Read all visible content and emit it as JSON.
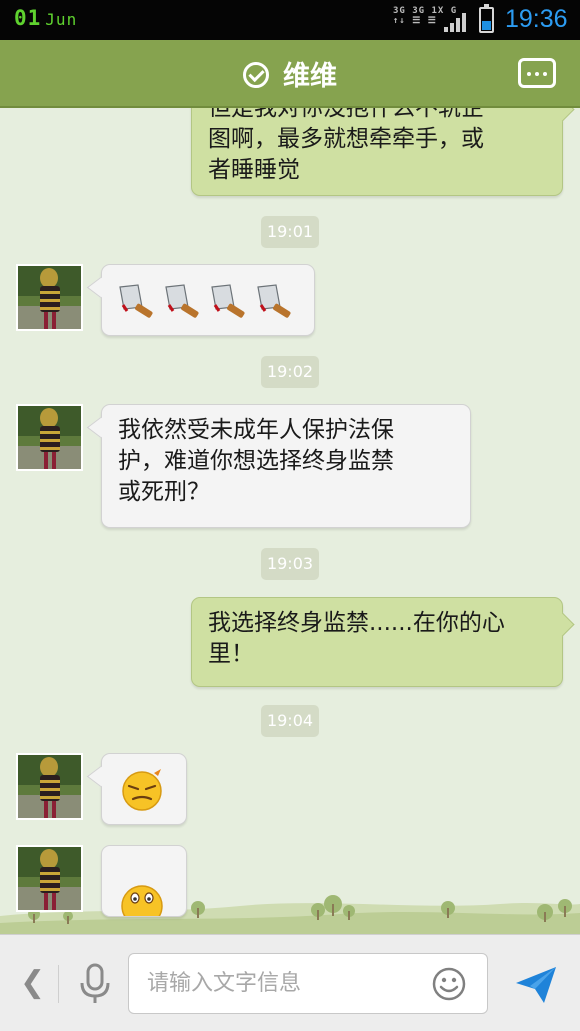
{
  "status_bar": {
    "date_day": "01",
    "date_month": "Jun",
    "network_1": "3G 3G 1X G",
    "network_2": "↑↓ ☰ ☰",
    "time": "19:36",
    "colors": {
      "clock": "#2c9cf2",
      "date": "#5fd22f"
    }
  },
  "header": {
    "title": "维维",
    "verified_icon": "check-circle-icon",
    "menu_icon": "more-dots-icon",
    "color": "#86a34f"
  },
  "messages": [
    {
      "type": "outgoing",
      "lines": [
        "但是我对你没抱什么不轨企",
        "图啊，最多就想牵牵手，或",
        "者睡睡觉"
      ]
    },
    {
      "type": "timestamp",
      "text": "19:01"
    },
    {
      "type": "incoming",
      "content": "4 kitchen-cleaver emoji",
      "icons": [
        "cleaver-icon",
        "cleaver-icon",
        "cleaver-icon",
        "cleaver-icon"
      ]
    },
    {
      "type": "timestamp",
      "text": "19:02"
    },
    {
      "type": "incoming",
      "lines": [
        "我依然受未成年人保护法保",
        "护，难道你想选择终身监禁",
        "或死刑？"
      ]
    },
    {
      "type": "timestamp",
      "text": "19:03"
    },
    {
      "type": "outgoing",
      "lines": [
        "我选择终身监禁......在你的心",
        "里！"
      ]
    },
    {
      "type": "timestamp",
      "text": "19:04"
    },
    {
      "type": "incoming",
      "content": "smirk emoji",
      "icons": [
        "smirk-emoji-icon"
      ]
    },
    {
      "type": "incoming",
      "content": "partially visible emoji",
      "icons": [
        "wide-eyes-emoji-icon"
      ]
    }
  ],
  "input_bar": {
    "placeholder": "请输入文字信息",
    "back_icon": "chevron-left-icon",
    "voice_icon": "microphone-icon",
    "emoji_icon": "smiley-face-icon",
    "send_icon": "send-plane-icon",
    "colors": {
      "send": "#1f83d9"
    }
  },
  "colors": {
    "chat_background": "#e6eede",
    "outgoing_bubble": "#cfe0a2",
    "incoming_bubble": "#f4f4f4",
    "timestamp_pill": "#d4dbc6"
  }
}
